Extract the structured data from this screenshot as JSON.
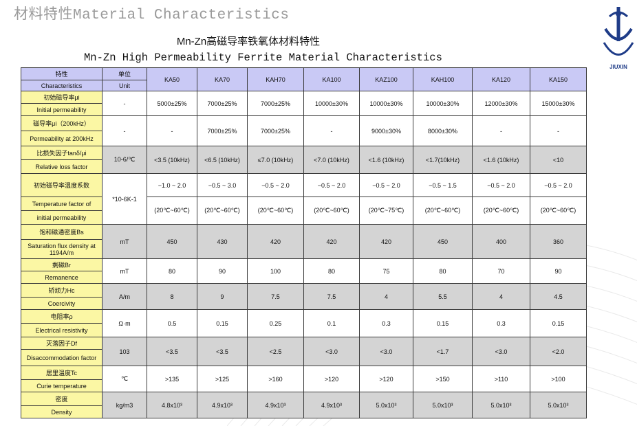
{
  "page_title": "材料特性Material Characteristics",
  "heading_cn": "Mn-Zn高磁导率铁氧体材料特性",
  "heading_en": "Mn-Zn High Permeability Ferrite Material Characteristics",
  "logo_text": "JIUXIN",
  "colors": {
    "header_bg": "#c9c9f5",
    "label_bg": "#fbf7a4",
    "grey_row": "#d4d4d4",
    "highlight_text": "#1e1ee0"
  },
  "table": {
    "header": {
      "char_cn": "特性",
      "char_en": "Characteristics",
      "unit_cn": "单位",
      "unit_en": "Unit",
      "grades": [
        "KA50",
        "KA70",
        "KAH70",
        "KA100",
        "KAZ100",
        "KAH100",
        "KA120",
        "KA150"
      ]
    },
    "rows": [
      {
        "label_cn": "初始磁导率μi",
        "label_en": "Initial permeability",
        "unit": "-",
        "values": [
          "5000±25%",
          "7000±25%",
          "7000±25%",
          "10000±30%",
          "10000±30%",
          "10000±30%",
          "12000±30%",
          "15000±30%"
        ]
      },
      {
        "label_cn": "磁导率μi（200kHz）",
        "label_en": "Permeability at 200kHz",
        "unit": "-",
        "values": [
          "-",
          "7000±25%",
          "7000±25%",
          "-",
          "9000±30%",
          "8000±30%",
          "-",
          "-"
        ]
      },
      {
        "label_cn": "比损失因子tanδ/μi",
        "label_en": "Relative loss factor",
        "unit": "10-6/℃",
        "values": [
          "<3.5 (10kHz)",
          "<6.5 (10kHz)",
          "≤7.0 (10kHz)",
          "<7.0 (10kHz)",
          "<1.6 (10kHz)",
          "<1.7(10kHz)",
          "<1.6 (10kHz)",
          "<10"
        ]
      },
      {
        "label_cn": "初始磁导率温度系数",
        "label_en_1": "Temperature factor of",
        "label_en_2": "initial permeability",
        "unit": "*10-6K-1",
        "values": [
          "−1.0 ~ 2.0",
          "−0.5 ~ 3.0",
          "−0.5 ~ 2.0",
          "−0.5 ~ 2.0",
          "−0.5 ~ 2.0",
          "−0.5 ~ 1.5",
          "−0.5 ~ 2.0",
          "−0.5 ~ 2.0"
        ],
        "ranges": [
          "(20℃~60℃)",
          "(20℃~60℃)",
          "(20℃~60℃)",
          "(20℃~60℃)",
          "(20℃~75℃)",
          "(20℃~60℃)",
          "(20℃~60℃)",
          "(20℃~60℃)"
        ]
      },
      {
        "label_cn": "饱和磁通密度Bs",
        "label_en": "Saturation flux density at 1194A/m",
        "unit": "mT",
        "values": [
          "450",
          "430",
          "420",
          "420",
          "420",
          "450",
          "400",
          "360"
        ]
      },
      {
        "label_cn": "剩磁Br",
        "label_en": "Remanence",
        "unit": "mT",
        "values": [
          "80",
          "90",
          "100",
          "80",
          "75",
          "80",
          "70",
          "90"
        ]
      },
      {
        "label_cn": "矫顽力Hc",
        "label_en": "Coercivity",
        "unit": "A/m",
        "values": [
          "8",
          "9",
          "7.5",
          "7.5",
          "4",
          "5.5",
          "4",
          "4.5"
        ]
      },
      {
        "label_cn": "电阻率ρ",
        "label_en": "Electrical resistivity",
        "unit": "Ω·m",
        "values": [
          "0.5",
          "0.15",
          "0.25",
          "0.1",
          "0.3",
          "0.15",
          "0.3",
          "0.15"
        ]
      },
      {
        "label_cn": "灭落因子Df",
        "label_en": "Disaccommodation factor",
        "unit": "103",
        "values": [
          "<3.5",
          "<3.5",
          "<2.5",
          "<3.0",
          "<3.0",
          "<1.7",
          "<3.0",
          "<2.0"
        ]
      },
      {
        "label_cn": "居里温度Tc",
        "label_en": "Curie temperature",
        "unit": "℃",
        "values": [
          ">135",
          ">125",
          ">160",
          ">120",
          ">120",
          ">150",
          ">110",
          ">100"
        ]
      },
      {
        "label_cn": "密度",
        "label_en": "Density",
        "unit": "kg/m3",
        "values": [
          "4.8x10³",
          "4.9x10³",
          "4.9x10³",
          "4.9x10³",
          "5.0x10³",
          "5.0x10³",
          "5.0x10³",
          "5.0x10³"
        ]
      }
    ]
  }
}
